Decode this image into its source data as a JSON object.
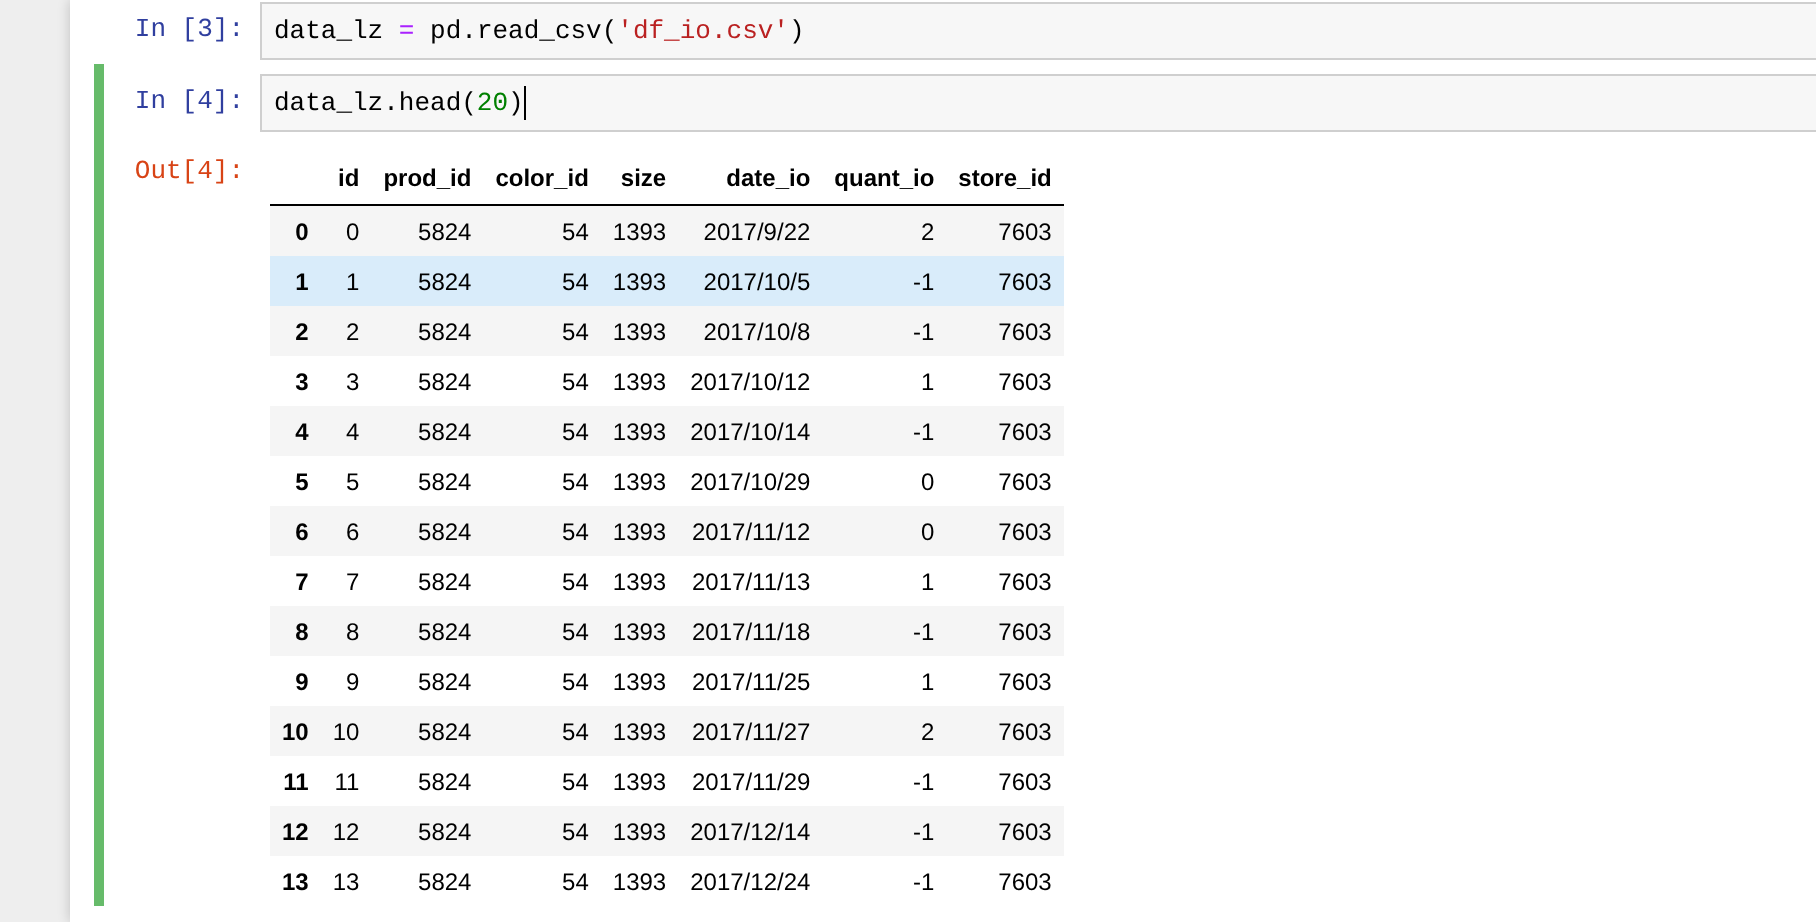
{
  "cells": [
    {
      "prompt": "In [3]:",
      "selected": false,
      "code": [
        {
          "kind": "name",
          "text": "data_lz "
        },
        {
          "kind": "operator",
          "text": "="
        },
        {
          "kind": "name",
          "text": " pd.read_csv("
        },
        {
          "kind": "string",
          "text": "'df_io.csv'"
        },
        {
          "kind": "name",
          "text": ")"
        }
      ]
    },
    {
      "prompt": "In [4]:",
      "selected": true,
      "code": [
        {
          "kind": "name",
          "text": "data_lz.head("
        },
        {
          "kind": "number",
          "text": "20"
        },
        {
          "kind": "name",
          "text": ")"
        }
      ],
      "output": {
        "prompt": "Out[4]:",
        "table": {
          "columns": [
            "id",
            "prod_id",
            "color_id",
            "size",
            "date_io",
            "quant_io",
            "store_id"
          ],
          "rows": [
            {
              "index": "0",
              "selected": false,
              "cells": [
                "0",
                "5824",
                "54",
                "1393",
                "2017/9/22",
                "2",
                "7603"
              ]
            },
            {
              "index": "1",
              "selected": true,
              "cells": [
                "1",
                "5824",
                "54",
                "1393",
                "2017/10/5",
                "-1",
                "7603"
              ]
            },
            {
              "index": "2",
              "selected": false,
              "cells": [
                "2",
                "5824",
                "54",
                "1393",
                "2017/10/8",
                "-1",
                "7603"
              ]
            },
            {
              "index": "3",
              "selected": false,
              "cells": [
                "3",
                "5824",
                "54",
                "1393",
                "2017/10/12",
                "1",
                "7603"
              ]
            },
            {
              "index": "4",
              "selected": false,
              "cells": [
                "4",
                "5824",
                "54",
                "1393",
                "2017/10/14",
                "-1",
                "7603"
              ]
            },
            {
              "index": "5",
              "selected": false,
              "cells": [
                "5",
                "5824",
                "54",
                "1393",
                "2017/10/29",
                "0",
                "7603"
              ]
            },
            {
              "index": "6",
              "selected": false,
              "cells": [
                "6",
                "5824",
                "54",
                "1393",
                "2017/11/12",
                "0",
                "7603"
              ]
            },
            {
              "index": "7",
              "selected": false,
              "cells": [
                "7",
                "5824",
                "54",
                "1393",
                "2017/11/13",
                "1",
                "7603"
              ]
            },
            {
              "index": "8",
              "selected": false,
              "cells": [
                "8",
                "5824",
                "54",
                "1393",
                "2017/11/18",
                "-1",
                "7603"
              ]
            },
            {
              "index": "9",
              "selected": false,
              "cells": [
                "9",
                "5824",
                "54",
                "1393",
                "2017/11/25",
                "1",
                "7603"
              ]
            },
            {
              "index": "10",
              "selected": false,
              "cells": [
                "10",
                "5824",
                "54",
                "1393",
                "2017/11/27",
                "2",
                "7603"
              ]
            },
            {
              "index": "11",
              "selected": false,
              "cells": [
                "11",
                "5824",
                "54",
                "1393",
                "2017/11/29",
                "-1",
                "7603"
              ]
            },
            {
              "index": "12",
              "selected": false,
              "cells": [
                "12",
                "5824",
                "54",
                "1393",
                "2017/12/14",
                "-1",
                "7603"
              ]
            },
            {
              "index": "13",
              "selected": false,
              "cells": [
                "13",
                "5824",
                "54",
                "1393",
                "2017/12/24",
                "-1",
                "7603"
              ]
            }
          ]
        }
      }
    }
  ]
}
